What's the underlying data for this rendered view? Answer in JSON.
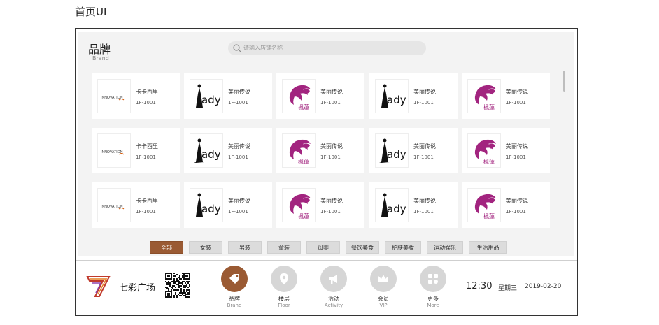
{
  "page_heading": "首页UI",
  "brand_section": {
    "title": "品牌",
    "subtitle": "Brand"
  },
  "search": {
    "placeholder": "请输入店铺名称"
  },
  "stores": [
    [
      {
        "name": "卡卡西里",
        "location": "1F-1001",
        "logo": "innovation-logo"
      },
      {
        "name": "美丽传说",
        "location": "1F-1001",
        "logo": "lady-logo"
      },
      {
        "name": "美丽传说",
        "location": "1F-1001",
        "logo": "purple-face-logo"
      },
      {
        "name": "美丽传说",
        "location": "1F-1001",
        "logo": "lady-logo"
      },
      {
        "name": "美丽传说",
        "location": "1F-1001",
        "logo": "purple-face-logo"
      }
    ],
    [
      {
        "name": "卡卡西里",
        "location": "1F-1001",
        "logo": "innovation-logo"
      },
      {
        "name": "美丽传说",
        "location": "1F-1001",
        "logo": "lady-logo"
      },
      {
        "name": "美丽传说",
        "location": "1F-1001",
        "logo": "purple-face-logo"
      },
      {
        "name": "美丽传说",
        "location": "1F-1001",
        "logo": "lady-logo"
      },
      {
        "name": "美丽传说",
        "location": "1F-1001",
        "logo": "purple-face-logo"
      }
    ],
    [
      {
        "name": "卡卡西里",
        "location": "1F-1001",
        "logo": "innovation-logo"
      },
      {
        "name": "美丽传说",
        "location": "1F-1001",
        "logo": "lady-logo"
      },
      {
        "name": "美丽传说",
        "location": "1F-1001",
        "logo": "purple-face-logo"
      },
      {
        "name": "美丽传说",
        "location": "1F-1001",
        "logo": "lady-logo"
      },
      {
        "name": "美丽传说",
        "location": "1F-1001",
        "logo": "purple-face-logo"
      }
    ]
  ],
  "logo_text": {
    "innovation": "INNOVATION",
    "lady": "ady",
    "purple": "楓蓮"
  },
  "filters": [
    "全部",
    "女装",
    "男装",
    "童装",
    "母婴",
    "餐饮美食",
    "护肤美妆",
    "运动娱乐",
    "生活用品"
  ],
  "active_filter": "全部",
  "mall": {
    "name": "七彩广场"
  },
  "nav": [
    {
      "label": "品牌",
      "sub": "Brand",
      "icon": "tag-icon",
      "active": true
    },
    {
      "label": "楼层",
      "sub": "Floor",
      "icon": "map-pin-icon",
      "active": false
    },
    {
      "label": "活动",
      "sub": "Activity",
      "icon": "megaphone-icon",
      "active": false
    },
    {
      "label": "会员",
      "sub": "VIP",
      "icon": "crown-icon",
      "active": false
    },
    {
      "label": "更多",
      "sub": "More",
      "icon": "apps-icon",
      "active": false
    }
  ],
  "clock": {
    "time": "12:30",
    "weekday": "星期三",
    "date": "2019-02-20"
  },
  "colors": {
    "accent": "#9a5a33",
    "inactive_icon": "#d6d6d6",
    "purple_logo": "#a2247f"
  }
}
